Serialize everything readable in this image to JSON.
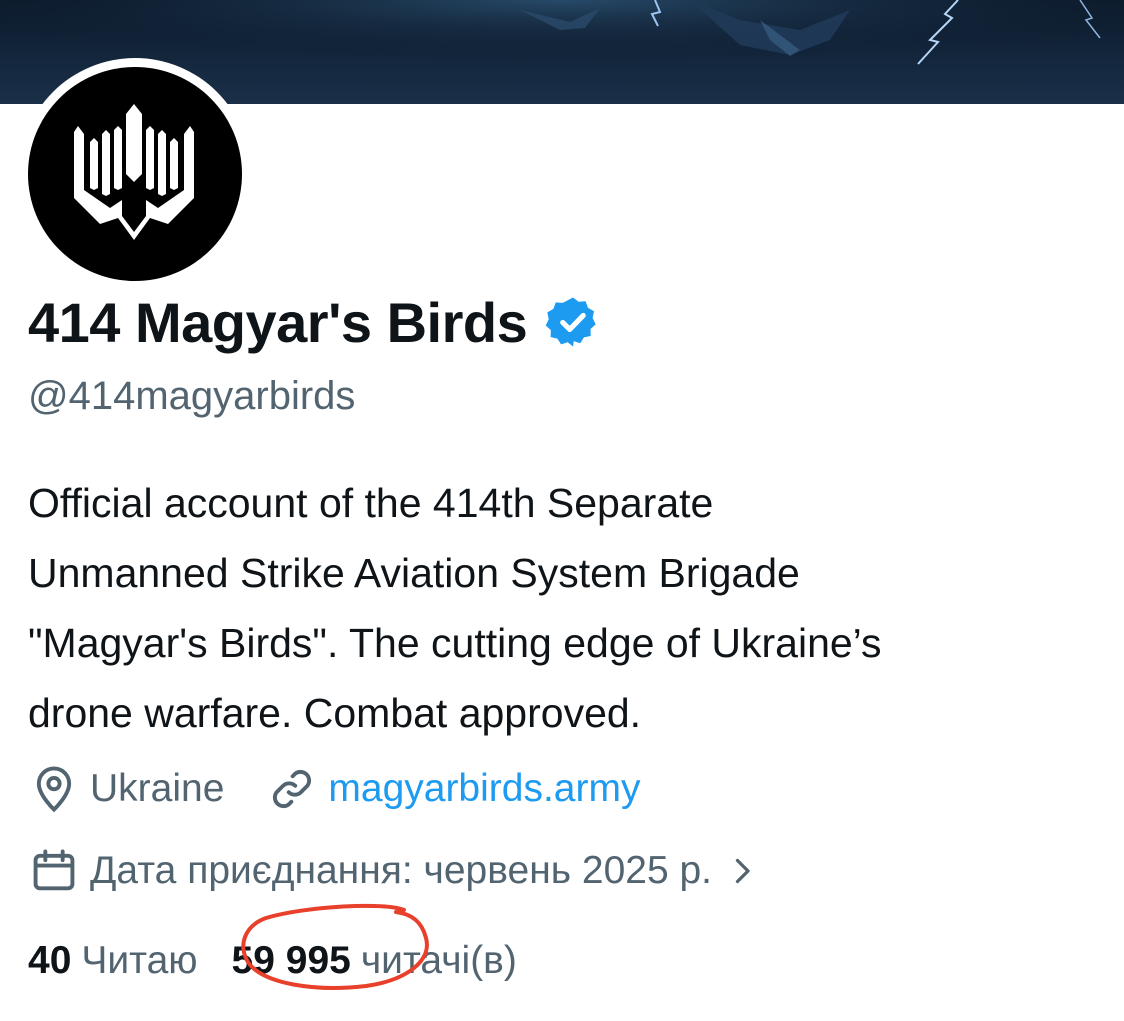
{
  "profile": {
    "display_name": "414 Magyar's Birds",
    "handle": "@414magyarbirds",
    "verified": true,
    "bio_lines": [
      "Official account of the 414th Separate",
      "Unmanned Strike Aviation System Brigade",
      "\"Magyar's Birds\". The cutting edge of Ukraine’s",
      "drone warfare. Combat approved."
    ],
    "location": "Ukraine",
    "website": "magyarbirds.army",
    "joined": "Дата приєднання: червень 2025 р.",
    "following_count": "40",
    "following_label": "Читаю",
    "followers_count": "59 995",
    "followers_label": "читачі(в)"
  },
  "icons": {
    "location": "location-pin-icon",
    "link": "link-icon",
    "calendar": "calendar-icon",
    "chevron": "chevron-right-icon",
    "verified": "verified-badge-icon"
  },
  "colors": {
    "text_primary": "#0f1419",
    "text_secondary": "#536471",
    "link": "#1d9bf0",
    "verified": "#1d9bf0",
    "annotation": "#e8402a"
  }
}
